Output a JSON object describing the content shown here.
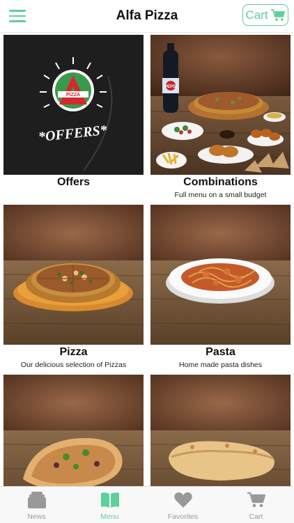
{
  "header": {
    "title": "Alfa Pizza",
    "cart_label": "Cart"
  },
  "tiles": [
    {
      "name": "Offers",
      "subtitle": "",
      "logo_text": "PIZZA",
      "badge_text": "*OFFERS*"
    },
    {
      "name": "Combinations",
      "subtitle": "Full menu on a small budget",
      "bottle_text": "PEPSI"
    },
    {
      "name": "Pizza",
      "subtitle": "Our delicious selection of Pizzas"
    },
    {
      "name": "Pasta",
      "subtitle": "Home made pasta dishes"
    },
    {
      "name": "",
      "subtitle": ""
    },
    {
      "name": "",
      "subtitle": ""
    }
  ],
  "tabbar": {
    "items": [
      {
        "label": "News",
        "icon": "news-icon",
        "active": false
      },
      {
        "label": "Menu",
        "icon": "book-icon",
        "active": true
      },
      {
        "label": "Favorites",
        "icon": "heart-icon",
        "active": false
      },
      {
        "label": "Cart",
        "icon": "cart-icon",
        "active": false
      }
    ]
  },
  "colors": {
    "accent": "#5ecf9a",
    "inactive": "#999999"
  }
}
